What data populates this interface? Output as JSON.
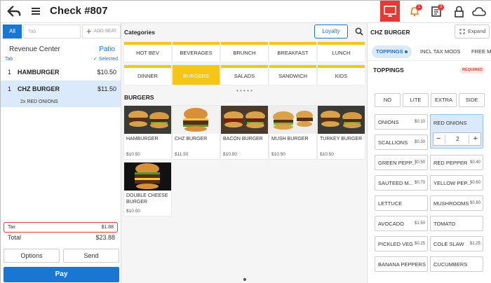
{
  "header": {
    "title": "Check #807",
    "notif_badge": "1",
    "orders_badge": "3",
    "colors": {
      "red_tile": "#e53935",
      "accent": "#1976d2"
    }
  },
  "left": {
    "tab_all": "All",
    "tab_placeholder": "Tab",
    "add_seat": "ADD SEAT",
    "revenue_center": "Revenue Center",
    "location": "Patio",
    "tab_label": "Tab",
    "selected_label": "Selected",
    "items": [
      {
        "qty": "1",
        "name": "HAMBURGER",
        "price": "$10.50"
      },
      {
        "qty": "1",
        "name": "CHZ BURGER",
        "price": "$11.50"
      }
    ],
    "modifier": "2x RED ONIONS",
    "tax_label": "Tax",
    "tax_value": "$1.88",
    "total_label": "Total",
    "total_value": "$23.88",
    "options": "Options",
    "send": "Send",
    "pay": "Pay"
  },
  "middle": {
    "categories_title": "Categories",
    "loyalty": "Loyalty",
    "categories": [
      "HOT BEV",
      "BEVERAGES",
      "BRUNCH",
      "BREAKFAST",
      "LUNCH",
      "DINNER",
      "BURGERS",
      "SALADS",
      "SANDWICH",
      "KIDS"
    ],
    "selected_category": "BURGERS",
    "section_title": "BURGERS",
    "items": [
      {
        "name": "HAMBURGER",
        "price": "$10.50"
      },
      {
        "name": "CHZ BURGER",
        "price": "$11.50"
      },
      {
        "name": "BACON BURGER",
        "price": "$10.50"
      },
      {
        "name": "MUSH BURGER",
        "price": "$10.50"
      },
      {
        "name": "TURKEY BURGER",
        "price": "$10.50"
      },
      {
        "name": "DOUBLE CHEESE BURGER",
        "price": "$10.00"
      }
    ]
  },
  "right": {
    "title": "CHZ BURGER",
    "expand": "Expand",
    "tabs": [
      "TOPPINGS",
      "INCL TAX MODS",
      "FREE M"
    ],
    "section": "TOPPINGS",
    "required": "REQUIRED",
    "amounts": [
      "NO",
      "LITE",
      "EXTRA",
      "SIDE"
    ],
    "options": [
      {
        "name": "ONIONS",
        "price": "$0.10"
      },
      {
        "name": "RED ONIONS",
        "price": ""
      },
      {
        "name": "SCALLIONS",
        "price": "$0.30"
      },
      {
        "name": "GREEN PEPP...",
        "price": "$0.50"
      },
      {
        "name": "RED PEPPER",
        "price": "$0.40"
      },
      {
        "name": "SAUTEED M...",
        "price": "$0.70"
      },
      {
        "name": "YELLOW PEP...",
        "price": "$0.60"
      },
      {
        "name": "LETTUCE",
        "price": ""
      },
      {
        "name": "MUSHROOMS",
        "price": "$0.80"
      },
      {
        "name": "AVOCADO",
        "price": "$1.50"
      },
      {
        "name": "TOMATO",
        "price": ""
      },
      {
        "name": "PICKLED VEG",
        "price": "$0.25"
      },
      {
        "name": "COLE SLAW",
        "price": "$1.25"
      },
      {
        "name": "BANANA PEPPERS",
        "price": ""
      },
      {
        "name": "CUCUMBERS",
        "price": ""
      }
    ],
    "stepper_value": "2"
  }
}
